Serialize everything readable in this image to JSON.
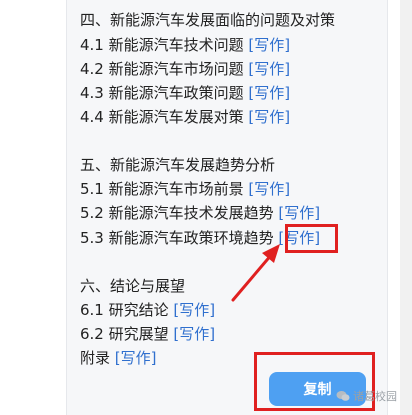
{
  "outline": [
    {
      "text": "四、新能源汽车发展面临的问题及对策",
      "write": ""
    },
    {
      "text": "4.1 新能源汽车技术问题 ",
      "write": "[写作]"
    },
    {
      "text": "4.2 新能源汽车市场问题 ",
      "write": "[写作]"
    },
    {
      "text": "4.3 新能源汽车政策问题 ",
      "write": "[写作]"
    },
    {
      "text": "4.4 新能源汽车发展对策 ",
      "write": "[写作]"
    },
    {
      "text": "五、新能源汽车发展趋势分析",
      "write": ""
    },
    {
      "text": "5.1 新能源汽车市场前景 ",
      "write": "[写作]"
    },
    {
      "text": "5.2 新能源汽车技术发展趋势 ",
      "write": "[写作]"
    },
    {
      "text": "5.3 新能源汽车政策环境趋势 ",
      "write": "[写作]"
    },
    {
      "text": "六、结论与展望",
      "write": ""
    },
    {
      "text": "6.1 研究结论 ",
      "write": "[写作]"
    },
    {
      "text": "6.2 研究展望 ",
      "write": "[写作]"
    },
    {
      "text": "附录 ",
      "write": "[写作]"
    }
  ],
  "copy_button": "复制",
  "watermark": "诸葛校园",
  "colors": {
    "link": "#2f6fce",
    "button": "#4ea0f2",
    "highlight": "#e02020"
  }
}
